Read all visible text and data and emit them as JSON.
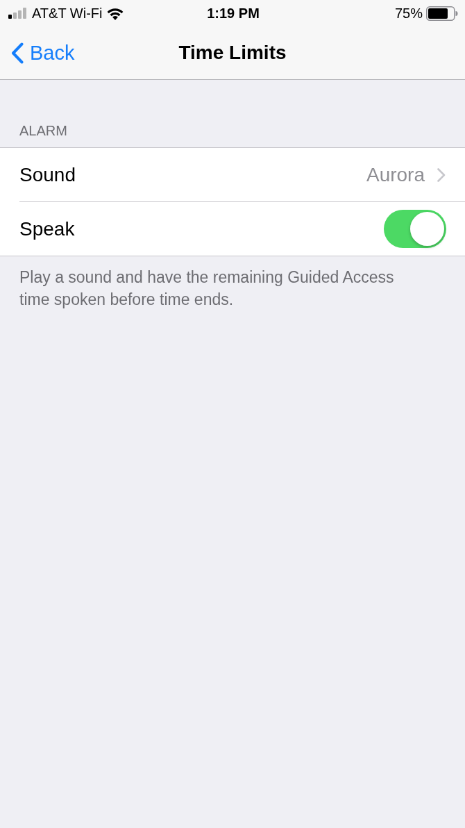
{
  "status_bar": {
    "carrier": "AT&T Wi-Fi",
    "time": "1:19 PM",
    "battery": "75%"
  },
  "nav_bar": {
    "back": "Back",
    "title": "Time Limits"
  },
  "section": {
    "header": "ALARM",
    "rows": [
      {
        "kind": "disclosure",
        "label": "Sound",
        "value": "Aurora"
      },
      {
        "kind": "toggle",
        "label": "Speak",
        "on": true
      }
    ],
    "footer": "Play a sound and have the remaining Guided Access time spoken before time ends."
  }
}
